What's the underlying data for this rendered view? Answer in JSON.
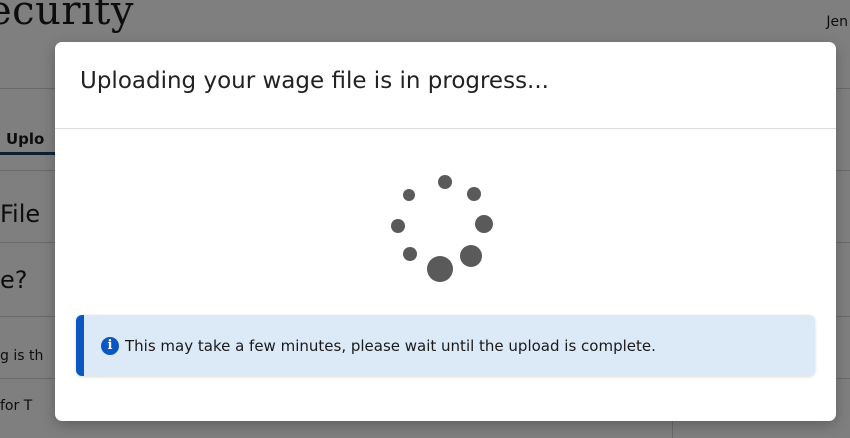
{
  "background": {
    "title": "ecurity",
    "user_name": "Jen",
    "tab_label": "Uplo",
    "heading_file": "File",
    "heading_question": "e?",
    "text_line_1": "g is th",
    "text_line_2": "for T"
  },
  "modal": {
    "title": "Uploading your wage file is in progress...",
    "spinner_icon": "loading-spinner-icon",
    "alert": {
      "icon": "info-circle-icon",
      "text": "This may take a few minutes, please wait until the upload is complete."
    }
  },
  "colors": {
    "overlay": "#000000",
    "alert_background": "#dce9f7",
    "alert_accent": "#0a57c2",
    "spinner": "#5a5a5a"
  }
}
